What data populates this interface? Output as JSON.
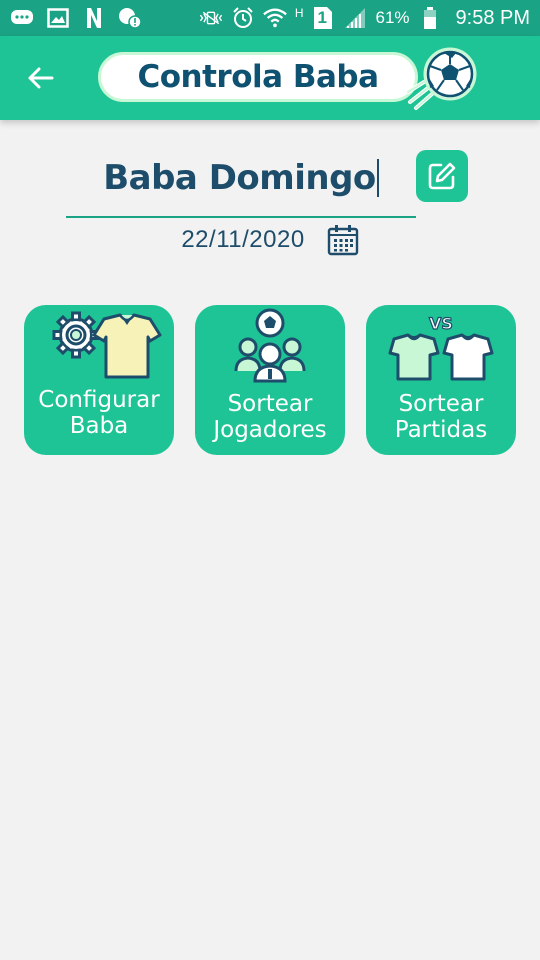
{
  "status_bar": {
    "battery_percent": "61%",
    "time": "9:58 PM",
    "network_label": "H",
    "sim_label": "1"
  },
  "app_bar": {
    "logo_text": "Controla Baba"
  },
  "baba": {
    "name": "Baba Domingo",
    "date": "22/11/2020"
  },
  "actions": [
    {
      "line1": "Configurar",
      "line2": "Baba"
    },
    {
      "line1": "Sortear",
      "line2": "Jogadores"
    },
    {
      "line1": "Sortear",
      "line2": "Partidas"
    }
  ],
  "versus_label": "VS",
  "colors": {
    "status_bar": "#1aa385",
    "app_bar": "#1ec495",
    "card": "#1ec495",
    "title": "#1e4d6b",
    "background": "#f2f2f2"
  }
}
